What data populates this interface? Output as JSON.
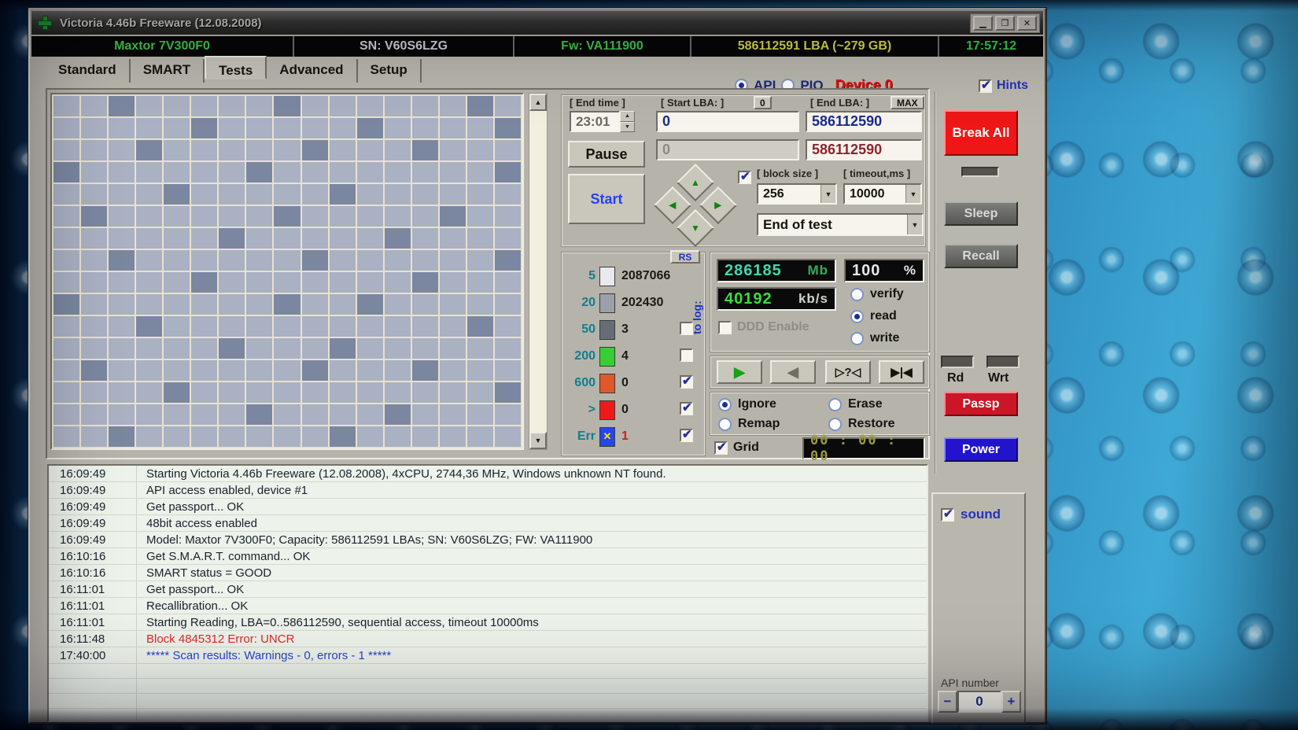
{
  "icons": {
    "minimize": "▁",
    "maximize": "❐",
    "close": "✕",
    "up": "▲",
    "down": "▼",
    "left": "◀",
    "right": "▶",
    "err_x": "✕",
    "play_fwd": "▶",
    "play_back": "◀",
    "scan_question": "▷?◁",
    "scan_edge": "▶|◀",
    "dropdown": "▼",
    "minus": "−",
    "plus": "+"
  },
  "titlebar": {
    "title": "Victoria 4.46b Freeware (12.08.2008)"
  },
  "infobar": {
    "model": "Maxtor 7V300F0",
    "serial": "SN: V60S6LZG",
    "firmware": "Fw: VA111900",
    "capacity": "586112591 LBA (~279 GB)",
    "clock": "17:57:12"
  },
  "tabs": {
    "items": [
      "Standard",
      "SMART",
      "Tests",
      "Advanced",
      "Setup"
    ],
    "active": "Tests"
  },
  "mode_row": {
    "api_label": "API",
    "api_selected": true,
    "pio_label": "PIO",
    "pio_selected": false,
    "device_label": "Device 0",
    "hints_label": "Hints",
    "hints_checked": true
  },
  "test_controls": {
    "end_time_label": "[ End time ]",
    "end_time_value": "23:01",
    "start_lba_label": "[ Start LBA: ]",
    "start_lba_button": "0",
    "start_lba_value": "0",
    "current_lba_value": "0",
    "end_lba_label": "[ End LBA: ]",
    "end_lba_button": "MAX",
    "end_lba_value": "586112590",
    "end_lba_current": "586112590",
    "pause_button": "Pause",
    "start_button": "Start",
    "pad_checkbox_checked": true,
    "block_size_label": "[ block size ]",
    "block_size_value": "256",
    "timeout_label": "[ timeout,ms ]",
    "timeout_value": "10000",
    "end_action": "End of test"
  },
  "counters": {
    "rs_button": "RS",
    "to_log_label": "to log:",
    "rows": [
      {
        "label": "5",
        "value": "2087066",
        "color": "#e8e9ee"
      },
      {
        "label": "20",
        "value": "202430",
        "color": "#9aa1ab"
      },
      {
        "label": "50",
        "value": "3",
        "color": "#676d77",
        "checked": false
      },
      {
        "label": "200",
        "value": "4",
        "color": "#35cf35",
        "checked": false
      },
      {
        "label": "600",
        "value": "0",
        "color": "#e0572a",
        "checked": true
      },
      {
        "label": ">",
        "value": "0",
        "color": "#ee1a1a",
        "checked": true
      },
      {
        "label": "Err",
        "value": "1",
        "color": "#2546e8",
        "checked": true,
        "value_color": "#d02020"
      }
    ]
  },
  "readouts": {
    "mb_value": "286185",
    "mb_unit": "Mb",
    "percent_value": "100",
    "percent_unit": "%",
    "speed_value": "40192",
    "speed_unit": "kb/s",
    "ddd_label": "DDD Enable",
    "ddd_checked": false,
    "modes": [
      {
        "label": "verify",
        "selected": false
      },
      {
        "label": "read",
        "selected": true
      },
      {
        "label": "write",
        "selected": false
      }
    ]
  },
  "repair": {
    "options": [
      {
        "label": "Ignore",
        "selected": true
      },
      {
        "label": "Erase",
        "selected": false
      },
      {
        "label": "Remap",
        "selected": false
      },
      {
        "label": "Restore",
        "selected": false
      }
    ]
  },
  "grid_row": {
    "label": "Grid",
    "checked": true,
    "timer": "00 : 00 : 00"
  },
  "sidebar": {
    "break_all": "Break All",
    "sleep": "Sleep",
    "recall": "Recall",
    "rd_label": "Rd",
    "wrt_label": "Wrt",
    "passp": "Passp",
    "power": "Power"
  },
  "log": {
    "entries": [
      {
        "time": "16:09:49",
        "text": "Starting Victoria 4.46b Freeware (12.08.2008), 4xCPU, 2744,36 MHz, Windows unknown NT found.",
        "color": "#18222e"
      },
      {
        "time": "16:09:49",
        "text": "API access enabled, device #1",
        "color": "#18222e"
      },
      {
        "time": "16:09:49",
        "text": "Get passport... OK",
        "color": "#18222e"
      },
      {
        "time": "16:09:49",
        "text": "48bit access enabled",
        "color": "#18222e"
      },
      {
        "time": "16:09:49",
        "text": "Model: Maxtor 7V300F0; Capacity: 586112591 LBAs; SN: V60S6LZG; FW: VA111900",
        "color": "#18222e"
      },
      {
        "time": "16:10:16",
        "text": "Get S.M.A.R.T. command... OK",
        "color": "#18222e"
      },
      {
        "time": "16:10:16",
        "text": "SMART status = GOOD",
        "color": "#18222e"
      },
      {
        "time": "16:11:01",
        "text": "Get passport... OK",
        "color": "#18222e"
      },
      {
        "time": "16:11:01",
        "text": "Recallibration... OK",
        "color": "#18222e"
      },
      {
        "time": "16:11:01",
        "text": "Starting Reading, LBA=0..586112590, sequential access, timeout 10000ms",
        "color": "#18222e"
      },
      {
        "time": "16:11:48",
        "text": "Block 4845312 Error: UNCR",
        "color": "#e02828"
      },
      {
        "time": "17:40:00",
        "text": "***** Scan results: Warnings - 0, errors - 1 *****",
        "color": "#2743cf"
      }
    ]
  },
  "bottom_right": {
    "sound_label": "sound",
    "sound_checked": true,
    "api_number_label": "API number",
    "value": "0"
  },
  "scan_grid": {
    "cols": 17,
    "rows": 16,
    "dark_cells": [
      [
        0,
        2
      ],
      [
        0,
        8
      ],
      [
        0,
        15
      ],
      [
        1,
        5
      ],
      [
        1,
        11
      ],
      [
        1,
        16
      ],
      [
        2,
        3
      ],
      [
        2,
        9
      ],
      [
        2,
        13
      ],
      [
        3,
        0
      ],
      [
        3,
        7
      ],
      [
        3,
        16
      ],
      [
        4,
        4
      ],
      [
        4,
        10
      ],
      [
        5,
        1
      ],
      [
        5,
        8
      ],
      [
        5,
        14
      ],
      [
        6,
        6
      ],
      [
        6,
        12
      ],
      [
        7,
        2
      ],
      [
        7,
        9
      ],
      [
        7,
        16
      ],
      [
        8,
        5
      ],
      [
        8,
        13
      ],
      [
        9,
        0
      ],
      [
        9,
        8
      ],
      [
        9,
        11
      ],
      [
        10,
        3
      ],
      [
        10,
        15
      ],
      [
        11,
        6
      ],
      [
        11,
        10
      ],
      [
        12,
        1
      ],
      [
        12,
        9
      ],
      [
        12,
        13
      ],
      [
        13,
        4
      ],
      [
        13,
        16
      ],
      [
        14,
        7
      ],
      [
        14,
        12
      ],
      [
        15,
        2
      ],
      [
        15,
        10
      ]
    ]
  }
}
